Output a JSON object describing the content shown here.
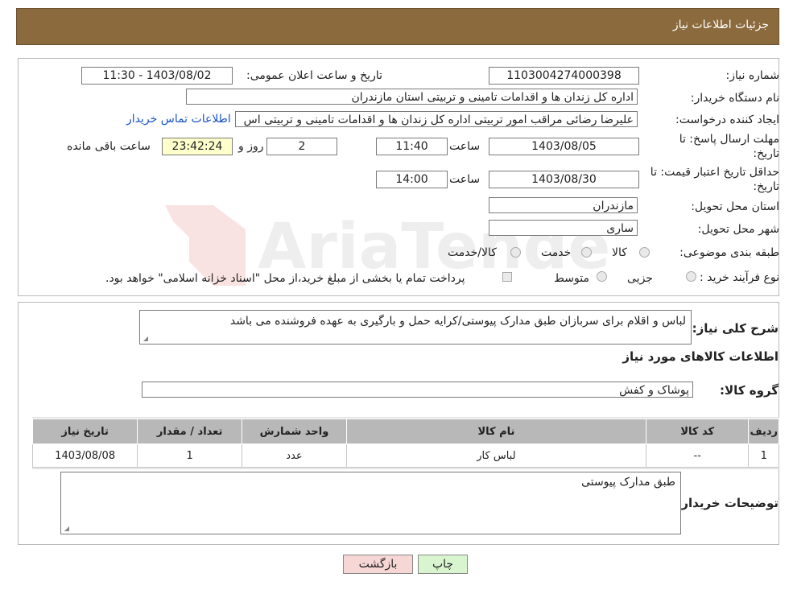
{
  "header": {
    "title": "جزئیات اطلاعات نیاز"
  },
  "labels": {
    "need_number": "شماره نیاز:",
    "announce_datetime": "تاریخ و ساعت اعلان عمومی:",
    "buyer_org": "نام دستگاه خریدار:",
    "requester": "ایجاد کننده درخواست:",
    "deadline": "مهلت ارسال پاسخ: تا تاریخ:",
    "time_word": "ساعت",
    "day_and": "روز و",
    "remaining": "ساعت باقی مانده",
    "price_validity": "حداقل تاریخ اعتبار قیمت: تا تاریخ:",
    "province": "استان محل تحویل:",
    "city": "شهر محل تحویل:",
    "category": "طبقه بندی موضوعی:",
    "purchase_type": "نوع فرآیند خرید :",
    "description": "شرح کلی نیاز:",
    "goods_info": "اطلاعات کالاهای مورد نیاز",
    "goods_group": "گروه کالا:",
    "buyer_notes": "توضیحات خریدار:"
  },
  "values": {
    "need_number": "1103004274000398",
    "announce_datetime": "1403/08/02 - 11:30",
    "buyer_org": "اداره کل زندان ها و اقدامات تامینی و تربیتی استان مازندران",
    "requester": "علیرضا رضائی مراقب امور تربیتی اداره کل زندان ها و اقدامات تامینی و تربیتی اس",
    "contact_link": "اطلاعات تماس خریدار",
    "deadline_date": "1403/08/05",
    "deadline_time": "11:40",
    "days_left": "2",
    "time_left": "23:42:24",
    "validity_date": "1403/08/30",
    "validity_time": "14:00",
    "province": "مازندران",
    "city": "ساری",
    "description": "لباس و اقلام برای سربازان طبق مدارک پیوستی/کرایه حمل و بارگیری به عهده فروشنده می باشد",
    "goods_group": "پوشاک و کفش",
    "buyer_notes": "طبق مدارک پیوستی"
  },
  "category_options": [
    "کالا",
    "خدمت",
    "کالا/خدمت"
  ],
  "purchase_options": [
    "جزیی",
    "متوسط"
  ],
  "payment_note": "پرداخت تمام یا بخشی از مبلغ خرید،از محل \"اسناد خزانه اسلامی\" خواهد بود.",
  "table": {
    "headers": [
      "ردیف",
      "کد کالا",
      "نام کالا",
      "واحد شمارش",
      "تعداد / مقدار",
      "تاریخ نیاز"
    ],
    "rows": [
      [
        "1",
        "--",
        "لباس کار",
        "عدد",
        "1",
        "1403/08/08"
      ]
    ]
  },
  "buttons": {
    "print": "چاپ",
    "back": "بازگشت"
  },
  "watermark": "AriaTender.neT",
  "colors": {
    "header_bg": "#8b6a3e",
    "link": "#1a55c8",
    "back_btn": "#f7d6d6",
    "print_btn": "#d9f5d0"
  }
}
